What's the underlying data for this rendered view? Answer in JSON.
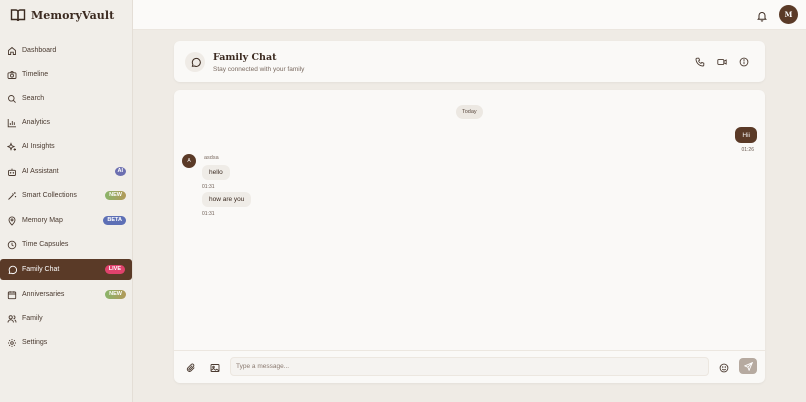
{
  "app": {
    "name": "MemoryVault"
  },
  "sidebar": {
    "items": [
      {
        "label": "Dashboard",
        "icon": "home-icon",
        "badge": ""
      },
      {
        "label": "Timeline",
        "icon": "camera-icon",
        "badge": ""
      },
      {
        "label": "Search",
        "icon": "search-icon",
        "badge": ""
      },
      {
        "label": "Analytics",
        "icon": "bar-chart-icon",
        "badge": ""
      },
      {
        "label": "AI Insights",
        "icon": "sparkles-icon",
        "badge": ""
      },
      {
        "label": "AI Assistant",
        "icon": "bot-icon",
        "badge": "AI"
      },
      {
        "label": "Smart Collections",
        "icon": "wand-icon",
        "badge": "NEW"
      },
      {
        "label": "Memory Map",
        "icon": "map-pin-icon",
        "badge": "BETA"
      },
      {
        "label": "Time Capsules",
        "icon": "clock-icon",
        "badge": ""
      },
      {
        "label": "Family Chat",
        "icon": "chat-icon",
        "badge": "LIVE",
        "active": true
      },
      {
        "label": "Anniversaries",
        "icon": "calendar-icon",
        "badge": "NEW"
      },
      {
        "label": "Family",
        "icon": "users-icon",
        "badge": ""
      },
      {
        "label": "Settings",
        "icon": "gear-icon",
        "badge": ""
      }
    ]
  },
  "topbar": {
    "avatar_initial": "M"
  },
  "chat": {
    "title": "Family Chat",
    "subtitle": "Stay connected with your family",
    "day_label": "Today",
    "messages": [
      {
        "direction": "out",
        "text": "Hii",
        "time": "01:26"
      },
      {
        "direction": "in",
        "sender": "asdsa",
        "sender_initial": "A",
        "text": "hello",
        "time": "01:31"
      },
      {
        "direction": "in",
        "sender": "asdsa",
        "sender_initial": "A",
        "text": "how are you",
        "time": "01:31"
      }
    ],
    "composer": {
      "placeholder": "Type a message..."
    }
  },
  "colors": {
    "primary": "#5a3a27",
    "live": "#e0426c",
    "beta": "#5d6fb5",
    "ai": "#6c6fb0"
  }
}
